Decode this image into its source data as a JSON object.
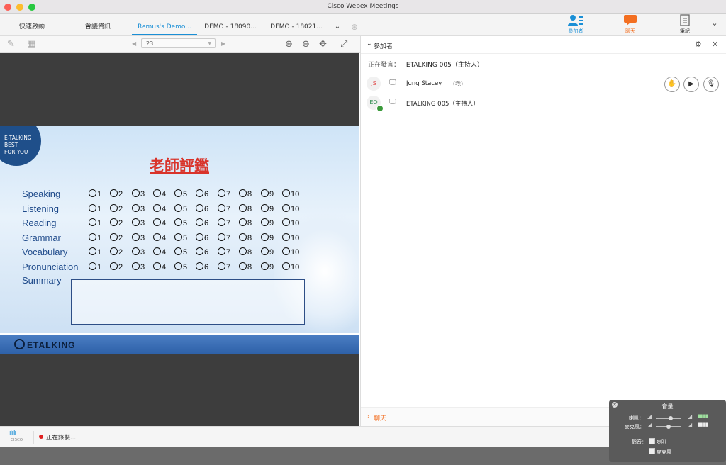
{
  "window": {
    "title": "Cisco Webex Meetings"
  },
  "tabs": [
    {
      "label": "快速啟動"
    },
    {
      "label": "會議資訊"
    },
    {
      "label": "Remus's Demo..."
    },
    {
      "label": "DEMO - 18090..."
    },
    {
      "label": "DEMO - 18021..."
    }
  ],
  "top_icons": {
    "participants": "參加者",
    "chat": "聊天",
    "notes": "筆記"
  },
  "toolbar": {
    "page": "23"
  },
  "slide": {
    "logo_lines": [
      "E-TALKING",
      "BEST",
      "FOR YOU"
    ],
    "title": "老師評鑑",
    "rows": [
      "Speaking",
      "Listening",
      "Reading",
      "Grammar",
      "Vocabulary",
      "Pronunciation"
    ],
    "options": [
      "1",
      "2",
      "3",
      "4",
      "5",
      "6",
      "7",
      "8",
      "9",
      "10"
    ],
    "summary_label": "Summary",
    "brand": "ETALKING"
  },
  "panel": {
    "title": "參加者",
    "speaking_label": "正在發言：",
    "speaking_name": "ETALKING 005（主持人）",
    "participants": [
      {
        "initials": "JS",
        "name": "Jung Stacey",
        "tag": "（我）"
      },
      {
        "initials": "EO",
        "name": "ETALKING 005（主持人）",
        "tag": ""
      }
    ],
    "chat_label": "聊天"
  },
  "bottom": {
    "cisco": "CISCO",
    "recording": "正在錄製..."
  },
  "audio": {
    "title": "音量",
    "speaker_label": "喇叭：",
    "mic_label": "麥克風：",
    "mute_label": "靜音：",
    "mute_speaker": "喇叭",
    "mute_mic": "麥克風"
  },
  "colors": {
    "accent": "#1a8fd6",
    "chat_orange": "#f36f21",
    "slide_title": "#d9342b",
    "recording": "#e02020"
  }
}
